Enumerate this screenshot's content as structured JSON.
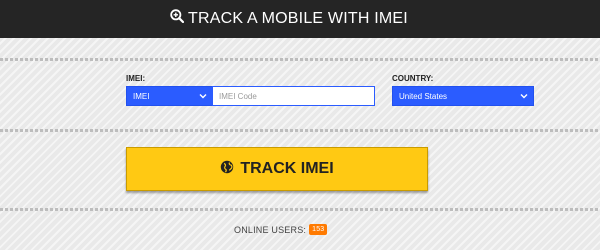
{
  "header": {
    "title": "TRACK A MOBILE WITH IMEI",
    "icon": "search-plus-icon"
  },
  "form": {
    "imei_label": "IMEI:",
    "imei_type_selected": "IMEI",
    "imei_input_placeholder": "IMEI Code",
    "imei_input_value": "",
    "country_label": "COUNTRY:",
    "country_selected": "United States"
  },
  "button": {
    "label": "TRACK IMEI",
    "icon": "globe-icon"
  },
  "footer": {
    "online_label": "ONLINE USERS:",
    "online_count": "153"
  },
  "colors": {
    "header_bg": "#252525",
    "select_bg": "#2b5cff",
    "button_bg": "#ffc913",
    "badge_bg": "#ff7a00"
  }
}
